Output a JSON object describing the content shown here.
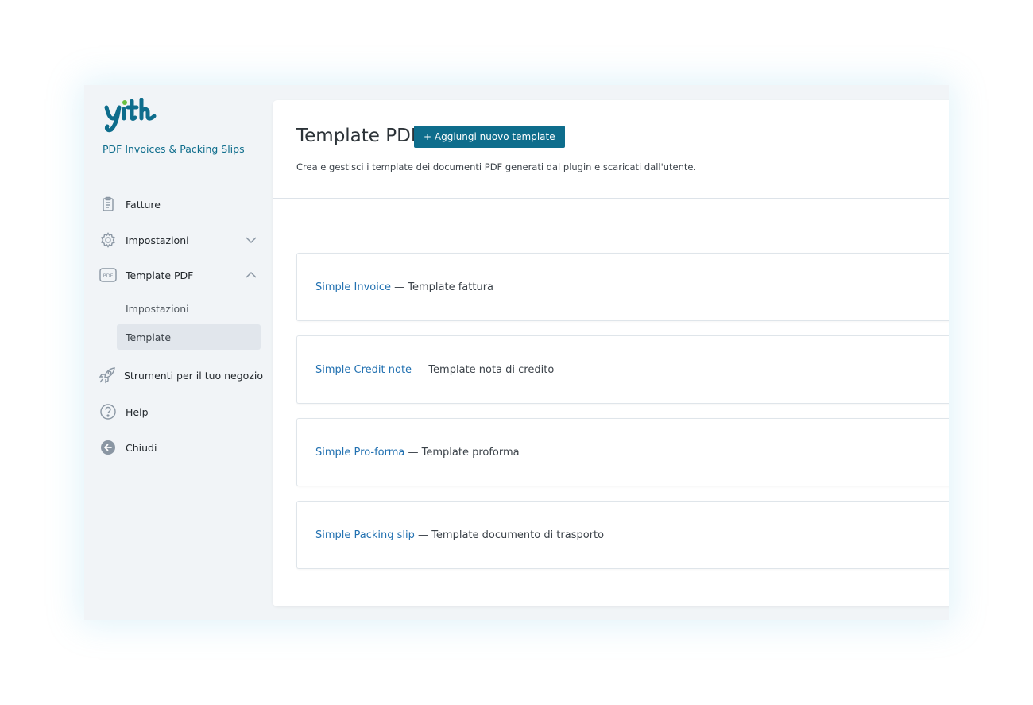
{
  "brand": {
    "logo_text": "yith",
    "plugin_name": "PDF Invoices & Packing Slips"
  },
  "sidebar": {
    "items": [
      {
        "label": "Fatture",
        "icon": "clipboard-icon"
      },
      {
        "label": "Impostazioni",
        "icon": "gear-icon",
        "expander": "chevron-down-icon"
      },
      {
        "label": "Template PDF",
        "icon": "pdf-icon",
        "expander": "chevron-up-icon"
      },
      {
        "label": "Strumenti per il tuo negozio",
        "icon": "rocket-icon"
      },
      {
        "label": "Help",
        "icon": "help-icon"
      },
      {
        "label": "Chiudi",
        "icon": "arrow-left-circle-icon"
      }
    ],
    "subitems": [
      {
        "label": "Impostazioni",
        "active": false
      },
      {
        "label": "Template",
        "active": true
      }
    ]
  },
  "page": {
    "title": "Template PDF",
    "add_button": "+ Aggiungi nuovo template",
    "description": "Crea e gestisci i template dei documenti PDF generati dal plugin e scaricati dall'utente."
  },
  "templates": [
    {
      "name": "Simple Invoice",
      "separator": "—",
      "description": "Template fattura"
    },
    {
      "name": "Simple Credit note",
      "separator": "—",
      "description": "Template nota di credito"
    },
    {
      "name": "Simple Pro-forma",
      "separator": "—",
      "description": "Template proforma"
    },
    {
      "name": "Simple Packing slip",
      "separator": "—",
      "description": "Template documento di trasporto"
    }
  ],
  "colors": {
    "accent": "#0e6d8c",
    "link": "#2271b1",
    "sidebar_bg": "#f1f4f7",
    "active_bg": "#e1e6ec"
  }
}
